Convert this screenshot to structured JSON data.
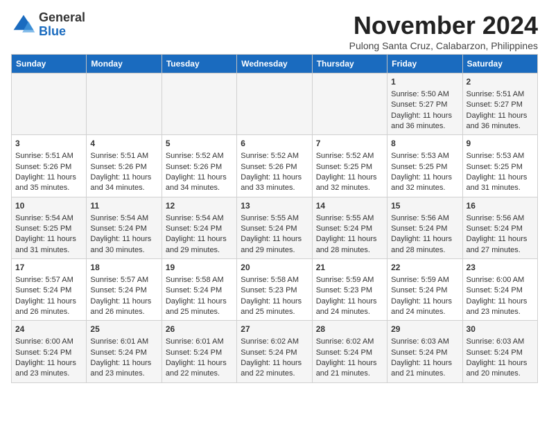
{
  "logo": {
    "general": "General",
    "blue": "Blue"
  },
  "title": "November 2024",
  "location": "Pulong Santa Cruz, Calabarzon, Philippines",
  "days_of_week": [
    "Sunday",
    "Monday",
    "Tuesday",
    "Wednesday",
    "Thursday",
    "Friday",
    "Saturday"
  ],
  "weeks": [
    [
      {
        "day": "",
        "info": ""
      },
      {
        "day": "",
        "info": ""
      },
      {
        "day": "",
        "info": ""
      },
      {
        "day": "",
        "info": ""
      },
      {
        "day": "",
        "info": ""
      },
      {
        "day": "1",
        "info": "Sunrise: 5:50 AM\nSunset: 5:27 PM\nDaylight: 11 hours and 36 minutes."
      },
      {
        "day": "2",
        "info": "Sunrise: 5:51 AM\nSunset: 5:27 PM\nDaylight: 11 hours and 36 minutes."
      }
    ],
    [
      {
        "day": "3",
        "info": "Sunrise: 5:51 AM\nSunset: 5:26 PM\nDaylight: 11 hours and 35 minutes."
      },
      {
        "day": "4",
        "info": "Sunrise: 5:51 AM\nSunset: 5:26 PM\nDaylight: 11 hours and 34 minutes."
      },
      {
        "day": "5",
        "info": "Sunrise: 5:52 AM\nSunset: 5:26 PM\nDaylight: 11 hours and 34 minutes."
      },
      {
        "day": "6",
        "info": "Sunrise: 5:52 AM\nSunset: 5:26 PM\nDaylight: 11 hours and 33 minutes."
      },
      {
        "day": "7",
        "info": "Sunrise: 5:52 AM\nSunset: 5:25 PM\nDaylight: 11 hours and 32 minutes."
      },
      {
        "day": "8",
        "info": "Sunrise: 5:53 AM\nSunset: 5:25 PM\nDaylight: 11 hours and 32 minutes."
      },
      {
        "day": "9",
        "info": "Sunrise: 5:53 AM\nSunset: 5:25 PM\nDaylight: 11 hours and 31 minutes."
      }
    ],
    [
      {
        "day": "10",
        "info": "Sunrise: 5:54 AM\nSunset: 5:25 PM\nDaylight: 11 hours and 31 minutes."
      },
      {
        "day": "11",
        "info": "Sunrise: 5:54 AM\nSunset: 5:24 PM\nDaylight: 11 hours and 30 minutes."
      },
      {
        "day": "12",
        "info": "Sunrise: 5:54 AM\nSunset: 5:24 PM\nDaylight: 11 hours and 29 minutes."
      },
      {
        "day": "13",
        "info": "Sunrise: 5:55 AM\nSunset: 5:24 PM\nDaylight: 11 hours and 29 minutes."
      },
      {
        "day": "14",
        "info": "Sunrise: 5:55 AM\nSunset: 5:24 PM\nDaylight: 11 hours and 28 minutes."
      },
      {
        "day": "15",
        "info": "Sunrise: 5:56 AM\nSunset: 5:24 PM\nDaylight: 11 hours and 28 minutes."
      },
      {
        "day": "16",
        "info": "Sunrise: 5:56 AM\nSunset: 5:24 PM\nDaylight: 11 hours and 27 minutes."
      }
    ],
    [
      {
        "day": "17",
        "info": "Sunrise: 5:57 AM\nSunset: 5:24 PM\nDaylight: 11 hours and 26 minutes."
      },
      {
        "day": "18",
        "info": "Sunrise: 5:57 AM\nSunset: 5:24 PM\nDaylight: 11 hours and 26 minutes."
      },
      {
        "day": "19",
        "info": "Sunrise: 5:58 AM\nSunset: 5:24 PM\nDaylight: 11 hours and 25 minutes."
      },
      {
        "day": "20",
        "info": "Sunrise: 5:58 AM\nSunset: 5:23 PM\nDaylight: 11 hours and 25 minutes."
      },
      {
        "day": "21",
        "info": "Sunrise: 5:59 AM\nSunset: 5:23 PM\nDaylight: 11 hours and 24 minutes."
      },
      {
        "day": "22",
        "info": "Sunrise: 5:59 AM\nSunset: 5:24 PM\nDaylight: 11 hours and 24 minutes."
      },
      {
        "day": "23",
        "info": "Sunrise: 6:00 AM\nSunset: 5:24 PM\nDaylight: 11 hours and 23 minutes."
      }
    ],
    [
      {
        "day": "24",
        "info": "Sunrise: 6:00 AM\nSunset: 5:24 PM\nDaylight: 11 hours and 23 minutes."
      },
      {
        "day": "25",
        "info": "Sunrise: 6:01 AM\nSunset: 5:24 PM\nDaylight: 11 hours and 23 minutes."
      },
      {
        "day": "26",
        "info": "Sunrise: 6:01 AM\nSunset: 5:24 PM\nDaylight: 11 hours and 22 minutes."
      },
      {
        "day": "27",
        "info": "Sunrise: 6:02 AM\nSunset: 5:24 PM\nDaylight: 11 hours and 22 minutes."
      },
      {
        "day": "28",
        "info": "Sunrise: 6:02 AM\nSunset: 5:24 PM\nDaylight: 11 hours and 21 minutes."
      },
      {
        "day": "29",
        "info": "Sunrise: 6:03 AM\nSunset: 5:24 PM\nDaylight: 11 hours and 21 minutes."
      },
      {
        "day": "30",
        "info": "Sunrise: 6:03 AM\nSunset: 5:24 PM\nDaylight: 11 hours and 20 minutes."
      }
    ]
  ]
}
